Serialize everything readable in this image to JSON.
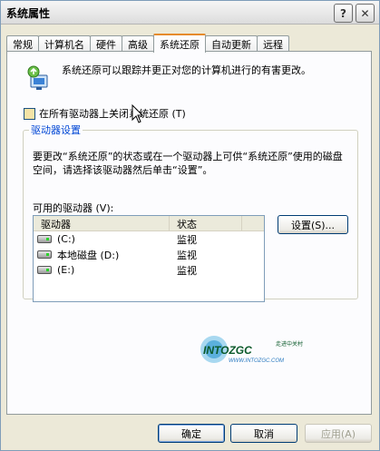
{
  "window": {
    "title": "系统属性",
    "help_button": "?",
    "close_button": "✕"
  },
  "tabs": [
    {
      "label": "常规",
      "active": false
    },
    {
      "label": "计算机名",
      "active": false
    },
    {
      "label": "硬件",
      "active": false
    },
    {
      "label": "高级",
      "active": false
    },
    {
      "label": "系统还原",
      "active": true
    },
    {
      "label": "自动更新",
      "active": false
    },
    {
      "label": "远程",
      "active": false
    }
  ],
  "panel": {
    "intro_text": "系统还原可以跟踪并更正对您的计算机进行的有害更改。",
    "disable_checkbox": {
      "label": "在所有驱动器上关闭系统还原 (T)",
      "checked": false
    },
    "drive_settings": {
      "legend": "驱动器设置",
      "description": "要更改“系统还原”的状态或在一个驱动器上可供“系统还原”使用的磁盘空间，请选择该驱动器然后单击“设置”。",
      "available_label": "可用的驱动器 (V):",
      "columns": [
        "驱动器",
        "状态"
      ],
      "drives": [
        {
          "name": "(C:)",
          "status": "监视"
        },
        {
          "name": "本地磁盘 (D:)",
          "status": "监视"
        },
        {
          "name": "(E:)",
          "status": "监视"
        }
      ],
      "settings_button": "设置(S)..."
    },
    "watermark": {
      "brand": "INTOZGC",
      "tagline": "走进中关村",
      "url": "WWW.INTOZGC.COM"
    }
  },
  "footer": {
    "ok": "确定",
    "cancel": "取消",
    "apply": "应用(A)"
  },
  "colors": {
    "accent": "#0046d5",
    "tab_highlight": "#e68b2c"
  }
}
